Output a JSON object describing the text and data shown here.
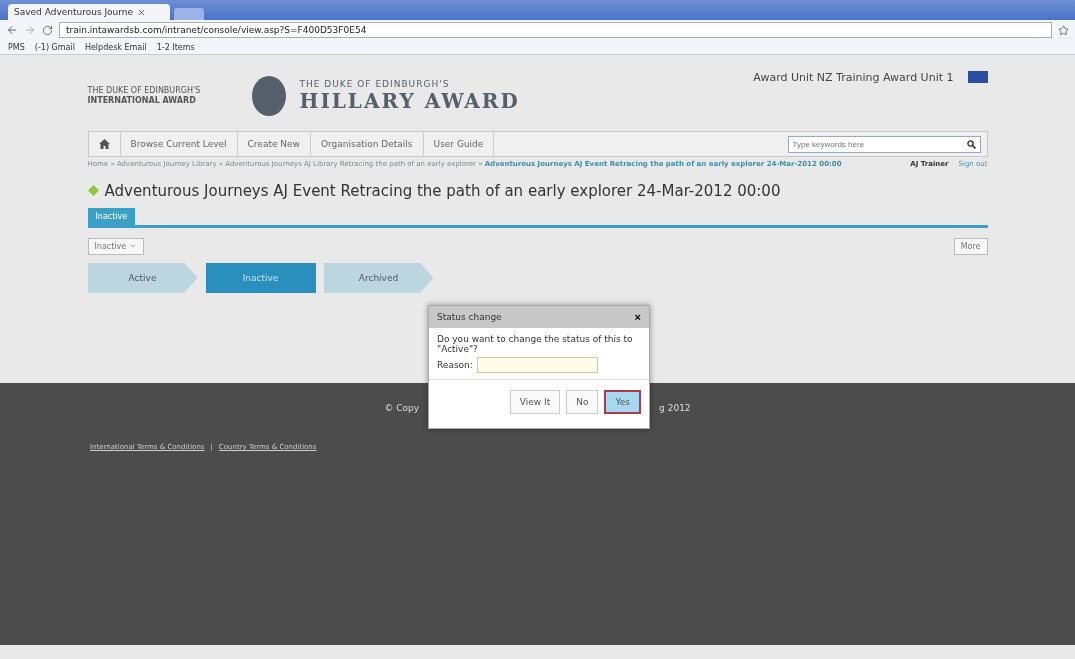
{
  "browser": {
    "tab_title": "Saved Adventurous Journe",
    "address": "train.intawardsb.com/intranet/console/view.asp?S=F400D53F0E54",
    "bookmarks": [
      "PMS",
      "(-1) Gmail",
      "Helpdesk Email",
      "1-2 Items"
    ]
  },
  "header": {
    "org_small": "THE DUKE OF EDINBURGH'S",
    "org_small2": "INTERNATIONAL AWARD",
    "brand_top": "THE DUKE OF EDINBURGH'S",
    "brand": "HILLARY AWARD",
    "unit": "Award Unit NZ Training Award Unit 1"
  },
  "nav": {
    "items": [
      "Browse Current Level",
      "Create New",
      "Organisation Details",
      "User Guide"
    ],
    "search": {
      "placeholder": "Type keywords here"
    }
  },
  "breadcrumb": {
    "path": "Home » Adventurous Journey Library » Adventurous Journeys AJ Library Retracing the path of an early explorer »",
    "current": "Adventurous Journeys AJ Event Retracing the path of an early explorer 24-Mar-2012 00:00",
    "user": "AJ Trainer",
    "sign_out": "Sign out"
  },
  "title": "Adventurous Journeys AJ Event Retracing the path of an early explorer 24-Mar-2012 00:00",
  "tabs": [
    {
      "label": "Inactive",
      "selected": true
    }
  ],
  "status_select": "Inactive",
  "more": "More",
  "steps": [
    {
      "label": "Active",
      "selected": false
    },
    {
      "label": "Inactive",
      "selected": true
    },
    {
      "label": "Archived",
      "selected": false
    }
  ],
  "dialog": {
    "title": "Status change",
    "close": "×",
    "message": "Do you want to change the status of this to \"Active\"?",
    "reason_label": "Reason:",
    "buttons": [
      {
        "label": "View It",
        "selected": false
      },
      {
        "label": "No",
        "selected": false
      },
      {
        "label": "Yes",
        "selected": true
      }
    ]
  },
  "footer": {
    "copyright_left": "© Copy",
    "copyright_right": "g 2012",
    "links": [
      "International Terms & Conditions",
      "Country Terms & Conditions"
    ],
    "separator": "|"
  }
}
